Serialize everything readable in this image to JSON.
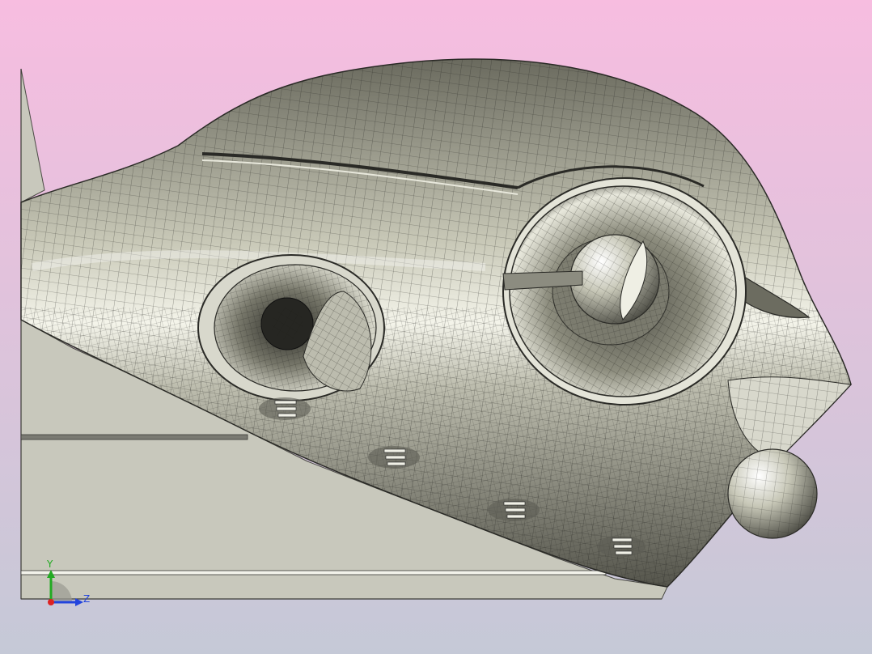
{
  "viewport": {
    "background_top": "#f7bde0",
    "background_bottom": "#c5c9d7",
    "model_fill": "#a9a998",
    "model_highlight": "#f4f4ea",
    "model_shadow": "#55554c",
    "mesh_color": "#1e1e1a",
    "plane_fill": "#c8c8bc",
    "plane_edge": "#4a4a44"
  },
  "triad": {
    "y_label": "Y",
    "z_label": "Z",
    "y_color": "#22aa22",
    "z_color": "#2244dd",
    "x_color": "#dd2222"
  }
}
